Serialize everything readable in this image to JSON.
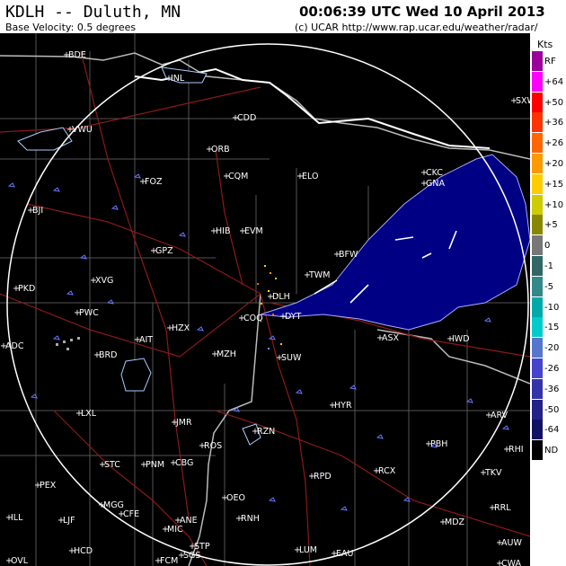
{
  "header": {
    "title": "KDLH -- Duluth, MN",
    "subtitle": "Base Velocity: 0.5 degrees",
    "timestamp": "00:06:39 UTC Wed 10 April 2013",
    "credit": "(c) UCAR  http://www.rap.ucar.edu/weather/radar/"
  },
  "legend": {
    "unit": "Kts",
    "items": [
      {
        "label": "RF",
        "color": "#9b009b"
      },
      {
        "label": "+64",
        "color": "#ff00ff"
      },
      {
        "label": "+50",
        "color": "#ff0000"
      },
      {
        "label": "+36",
        "color": "#ff3300"
      },
      {
        "label": "+26",
        "color": "#ff6600"
      },
      {
        "label": "+20",
        "color": "#ff9900"
      },
      {
        "label": "+15",
        "color": "#ffcc00"
      },
      {
        "label": "+10",
        "color": "#cccc00"
      },
      {
        "label": "+5",
        "color": "#888800"
      },
      {
        "label": "0",
        "color": "#777777"
      },
      {
        "label": "-1",
        "color": "#336666"
      },
      {
        "label": "-5",
        "color": "#338888"
      },
      {
        "label": "-10",
        "color": "#00aaaa"
      },
      {
        "label": "-15",
        "color": "#00cccc"
      },
      {
        "label": "-20",
        "color": "#5577cc"
      },
      {
        "label": "-26",
        "color": "#4444cc"
      },
      {
        "label": "-36",
        "color": "#3333aa"
      },
      {
        "label": "-50",
        "color": "#222288"
      },
      {
        "label": "-64",
        "color": "#111166"
      },
      {
        "label": "ND",
        "color": "#000000"
      }
    ]
  },
  "map": {
    "stations": [
      "BDE",
      "INL",
      "CDD",
      "ORB",
      "CQM",
      "ELO",
      "CKC",
      "GNA",
      "FOZ",
      "VWU",
      "BJI",
      "HIB",
      "EVM",
      "GPZ",
      "BFW",
      "XVG",
      "TWM",
      "PKD",
      "DLH",
      "COQ",
      "DYT",
      "PWC",
      "HZX",
      "ADC",
      "AIT",
      "BRD",
      "MZH",
      "ASX",
      "IWD",
      "SUW",
      "HYR",
      "LXL",
      "JMR",
      "ARV",
      "RZN",
      "ROS",
      "PBH",
      "STC",
      "PNM",
      "CBG",
      "RPD",
      "RCX",
      "TKV",
      "PEX",
      "OEO",
      "MGG",
      "LJF",
      "CFE",
      "ILL",
      "ANE",
      "RNH",
      "MIC",
      "RRL",
      "MDZ",
      "HCD",
      "STP",
      "SGS",
      "AUW",
      "FCM",
      "LUM",
      "EAU",
      "OVL",
      "CWA",
      "RHI",
      "SXW"
    ]
  }
}
